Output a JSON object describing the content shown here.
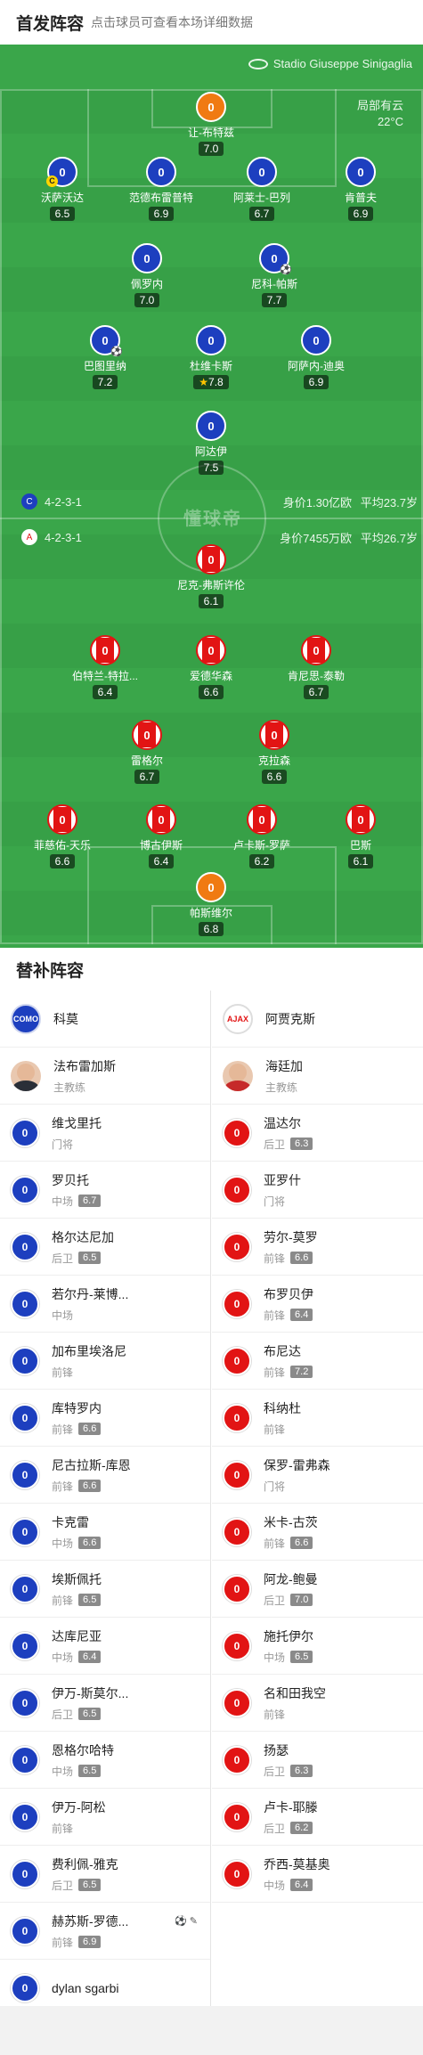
{
  "header": {
    "title": "首发阵容",
    "subtitle": "点击球员可查看本场详细数据"
  },
  "venue": {
    "name": "Stadio Giuseppe Sinigaglia"
  },
  "weather": {
    "condition": "局部有云",
    "temp": "22°C"
  },
  "watermark": "懂球帝",
  "home": {
    "formation": "4-2-3-1",
    "value": "身价1.30亿欧",
    "avg_age": "平均23.7岁",
    "color": "#1d3fbf",
    "lineup": [
      {
        "name": "让-布特兹",
        "rating": "7.0",
        "number": "0",
        "gk": true
      },
      {
        "name": "沃萨沃达",
        "rating": "6.5",
        "number": "0",
        "captain": true
      },
      {
        "name": "范德布雷普特",
        "rating": "6.9",
        "number": "0"
      },
      {
        "name": "阿莱士-巴列",
        "rating": "6.7",
        "number": "0"
      },
      {
        "name": "肯普夫",
        "rating": "6.9",
        "number": "0"
      },
      {
        "name": "佩罗内",
        "rating": "7.0",
        "number": "0"
      },
      {
        "name": "尼科-帕斯",
        "rating": "7.7",
        "number": "0",
        "sub_icon": true
      },
      {
        "name": "巴图里纳",
        "rating": "7.2",
        "number": "0",
        "goal": true
      },
      {
        "name": "杜维卡斯",
        "rating": "7.8",
        "number": "0",
        "mvp": true
      },
      {
        "name": "阿萨内-迪奥",
        "rating": "6.9",
        "number": "0"
      },
      {
        "name": "阿达伊",
        "rating": "7.5",
        "number": "0"
      }
    ]
  },
  "away": {
    "formation": "4-2-3-1",
    "value": "身价7455万欧",
    "avg_age": "平均26.7岁",
    "color": "#e21414",
    "lineup": [
      {
        "name": "尼克-弗斯许伦",
        "rating": "6.1",
        "number": "0"
      },
      {
        "name": "伯特兰-特拉...",
        "rating": "6.4",
        "number": "0"
      },
      {
        "name": "爱德华森",
        "rating": "6.6",
        "number": "0"
      },
      {
        "name": "肯尼思-泰勒",
        "rating": "6.7",
        "number": "0"
      },
      {
        "name": "雷格尔",
        "rating": "6.7",
        "number": "0"
      },
      {
        "name": "克拉森",
        "rating": "6.6",
        "number": "0"
      },
      {
        "name": "菲慈佑-天乐",
        "rating": "6.6",
        "number": "0"
      },
      {
        "name": "博古伊斯",
        "rating": "6.4",
        "number": "0"
      },
      {
        "name": "卢卡斯-罗萨",
        "rating": "6.2",
        "number": "0"
      },
      {
        "name": "巴斯",
        "rating": "6.1",
        "number": "0"
      },
      {
        "name": "帕斯维尔",
        "rating": "6.8",
        "number": "0",
        "gk": true
      }
    ]
  },
  "subs_title": "替补阵容",
  "home_subs": {
    "team": "科莫",
    "coach": {
      "name": "法布雷加斯",
      "role": "主教练"
    },
    "players": [
      {
        "name": "维戈里托",
        "pos": "门将",
        "rating": ""
      },
      {
        "name": "罗贝托",
        "pos": "中场",
        "rating": "6.7"
      },
      {
        "name": "格尔达尼加",
        "pos": "后卫",
        "rating": "6.5"
      },
      {
        "name": "若尔丹-莱博...",
        "pos": "中场",
        "rating": ""
      },
      {
        "name": "加布里埃洛尼",
        "pos": "前锋",
        "rating": ""
      },
      {
        "name": "库特罗内",
        "pos": "前锋",
        "rating": "6.6"
      },
      {
        "name": "尼古拉斯-库恩",
        "pos": "前锋",
        "rating": "6.6"
      },
      {
        "name": "卡克雷",
        "pos": "中场",
        "rating": "6.6"
      },
      {
        "name": "埃斯佩托",
        "pos": "前锋",
        "rating": "6.5"
      },
      {
        "name": "达库尼亚",
        "pos": "中场",
        "rating": "6.4"
      },
      {
        "name": "伊万-斯莫尔...",
        "pos": "后卫",
        "rating": "6.5"
      },
      {
        "name": "恩格尔哈特",
        "pos": "中场",
        "rating": "6.5"
      },
      {
        "name": "伊万-阿松",
        "pos": "前锋",
        "rating": ""
      },
      {
        "name": "费利佩-雅克",
        "pos": "后卫",
        "rating": "6.5"
      },
      {
        "name": "赫苏斯-罗德...",
        "pos": "前锋",
        "rating": "6.9",
        "events": "⚽ ✎"
      },
      {
        "name": "dylan sgarbi",
        "pos": "",
        "rating": ""
      }
    ]
  },
  "away_subs": {
    "team": "阿贾克斯",
    "coach": {
      "name": "海廷加",
      "role": "主教练"
    },
    "players": [
      {
        "name": "温达尔",
        "pos": "后卫",
        "rating": "6.3"
      },
      {
        "name": "亚罗什",
        "pos": "门将",
        "rating": ""
      },
      {
        "name": "劳尔-莫罗",
        "pos": "前锋",
        "rating": "6.6"
      },
      {
        "name": "布罗贝伊",
        "pos": "前锋",
        "rating": "6.4"
      },
      {
        "name": "布尼达",
        "pos": "前锋",
        "rating": "7.2"
      },
      {
        "name": "科纳杜",
        "pos": "前锋",
        "rating": ""
      },
      {
        "name": "保罗-雷弗森",
        "pos": "门将",
        "rating": ""
      },
      {
        "name": "米卡-古茨",
        "pos": "前锋",
        "rating": "6.6"
      },
      {
        "name": "阿龙-鲍曼",
        "pos": "后卫",
        "rating": "7.0"
      },
      {
        "name": "施托伊尔",
        "pos": "中场",
        "rating": "6.5"
      },
      {
        "name": "名和田我空",
        "pos": "前锋",
        "rating": ""
      },
      {
        "name": "扬瑟",
        "pos": "后卫",
        "rating": "6.3"
      },
      {
        "name": "卢卡-耶滕",
        "pos": "后卫",
        "rating": "6.2"
      },
      {
        "name": "乔西-莫基奥",
        "pos": "中场",
        "rating": "6.4"
      }
    ]
  }
}
